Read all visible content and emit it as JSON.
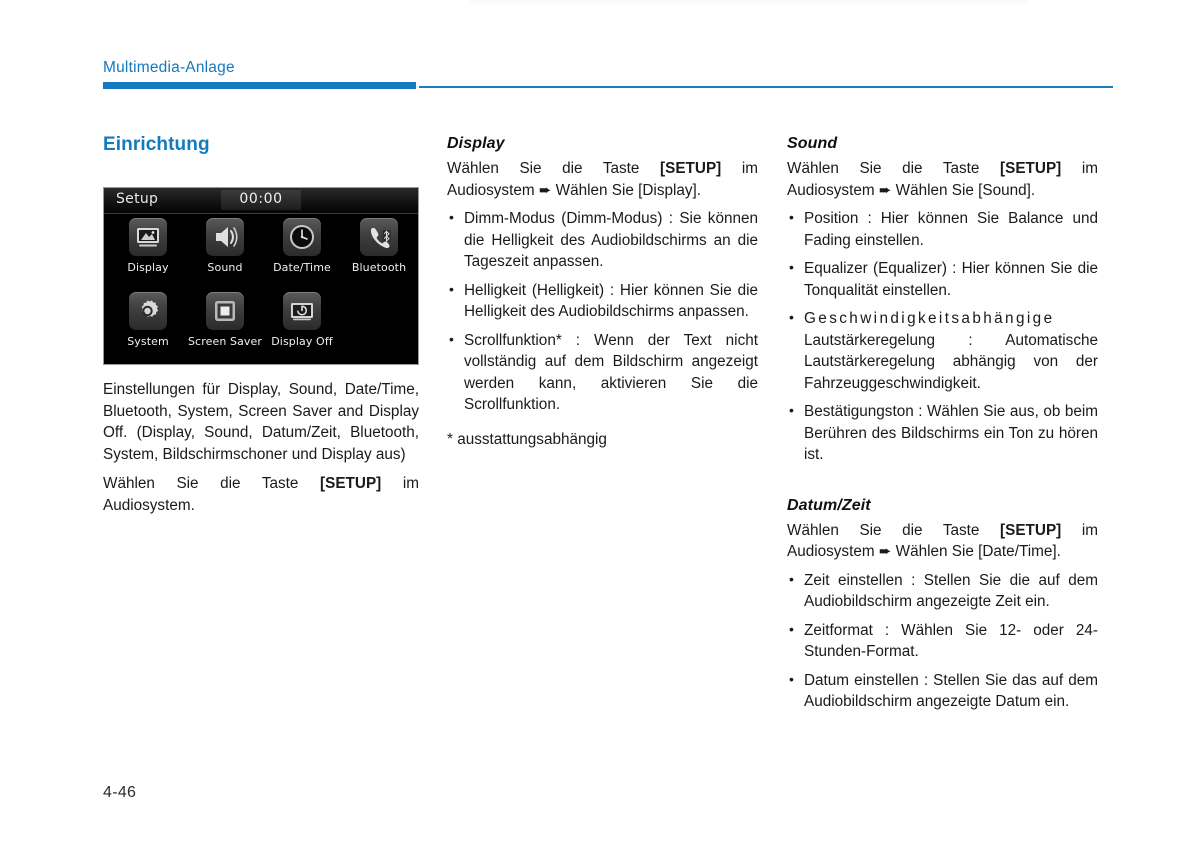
{
  "header": {
    "title": "Multimedia-Anlage"
  },
  "page_number": "4-46",
  "left_column": {
    "section_title": "Einrichtung",
    "device": {
      "title": "Setup",
      "clock": "00:00",
      "icons": [
        {
          "label": "Display",
          "icon": "picture-icon"
        },
        {
          "label": "Sound",
          "icon": "speaker-icon"
        },
        {
          "label": "Date/Time",
          "icon": "clock-icon"
        },
        {
          "label": "Bluetooth",
          "icon": "bluetooth-phone-icon"
        },
        {
          "label": "System",
          "icon": "gear-icon"
        },
        {
          "label": "Screen Saver",
          "icon": "screen-saver-icon"
        },
        {
          "label": "Display Off",
          "icon": "display-off-icon"
        }
      ]
    },
    "paragraph_1": "Einstellungen für Display, Sound, Date/Time, Bluetooth, System, Screen Saver and Display Off. (Display, Sound, Datum/Zeit, Bluetooth, System, Bildschirmschoner und Display aus)",
    "paragraph_2_pre": "Wählen Sie die Taste ",
    "paragraph_2_bold": "[SETUP]",
    "paragraph_2_post": " im Audiosystem."
  },
  "middle_column": {
    "sub_title": "Display",
    "intro_pre": "Wählen Sie die Taste ",
    "intro_bold": "[SETUP]",
    "intro_post": " im Audiosystem",
    "intro_arrow": "➨",
    "intro_tail": "Wählen Sie [Display].",
    "bullets": [
      "Dimm-Modus (Dimm-Modus) : Sie können die Helligkeit des Audiobildschirms an die Tageszeit anpassen.",
      "Helligkeit (Helligkeit) : Hier können Sie die Helligkeit des Audiobildschirms anpassen.",
      "Scrollfunktion* : Wenn der Text nicht vollständig auf dem Bildschirm angezeigt werden kann, aktivieren Sie die Scrollfunktion."
    ],
    "footnote": "* ausstattungsabhängig"
  },
  "right_column": {
    "sound": {
      "sub_title": "Sound",
      "intro_pre": "Wählen Sie die Taste ",
      "intro_bold": "[SETUP]",
      "intro_post": " im Audiosystem",
      "intro_arrow": "➨",
      "intro_tail": "Wählen Sie [Sound].",
      "bullets": [
        "Position : Hier können Sie Balance und Fading einstellen.",
        "Equalizer (Equalizer) : Hier können Sie die Tonqualität einstellen.",
        "Bestätigungston : Wählen Sie aus, ob beim Berühren des Bildschirms ein Ton zu hören ist."
      ],
      "bullet_speed_word": "Geschwindigkeitsabhängige",
      "bullet_speed_rest": "Lautstärkeregelung : Automatische Lautstärkeregelung abhängig von der Fahrzeuggeschwindigkeit."
    },
    "datetime": {
      "sub_title": "Datum/Zeit",
      "intro_pre": "Wählen Sie die Taste ",
      "intro_bold": "[SETUP]",
      "intro_post": " im Audiosystem",
      "intro_arrow": "➨",
      "intro_tail": "Wählen Sie [Date/Time].",
      "bullets": [
        "Zeit einstellen : Stellen Sie die auf dem Audiobildschirm angezeigte Zeit ein.",
        "Zeitformat : Wählen Sie 12- oder 24-Stunden-Format.",
        "Datum einstellen : Stellen Sie das auf dem Audiobildschirm angezeigte Datum ein."
      ]
    }
  }
}
